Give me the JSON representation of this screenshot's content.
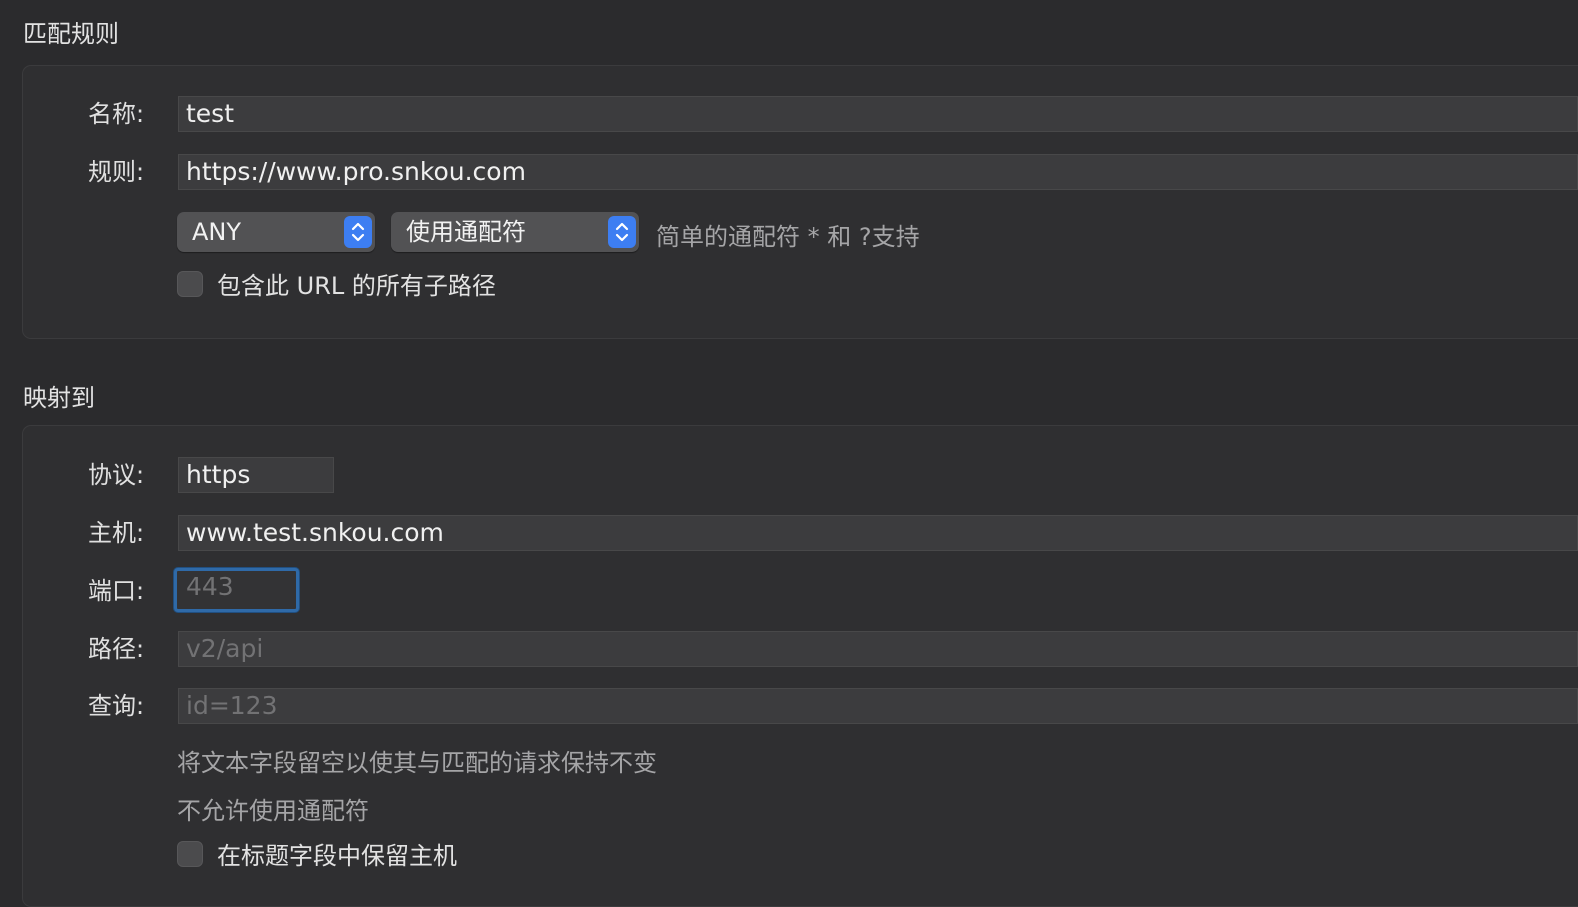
{
  "match_rules": {
    "title": "匹配规则",
    "name_label": "名称:",
    "name_value": "test",
    "rule_label": "规则:",
    "rule_value": "https://www.pro.snkou.com",
    "method_select": "ANY",
    "wildcard_select": "使用通配符",
    "wildcard_hint": "简单的通配符 * 和 ?支持",
    "include_subpaths_label": "包含此 URL 的所有子路径"
  },
  "map_to": {
    "title": "映射到",
    "protocol_label": "协议:",
    "protocol_value": "https",
    "host_label": "主机:",
    "host_value": "www.test.snkou.com",
    "port_label": "端口:",
    "port_placeholder": "443",
    "path_label": "路径:",
    "path_placeholder": "v2/api",
    "query_label": "查询:",
    "query_placeholder": "id=123",
    "note_empty": "将文本字段留空以使其与匹配的请求保持不变",
    "note_no_wildcard": "不允许使用通配符",
    "preserve_host_label": "在标题字段中保留主机"
  },
  "colors": {
    "background": "#2b2b2d",
    "accent": "#3d7ef2",
    "focus_ring": "#2f6aa8"
  },
  "icons": [
    "chevron-updown-icon"
  ]
}
